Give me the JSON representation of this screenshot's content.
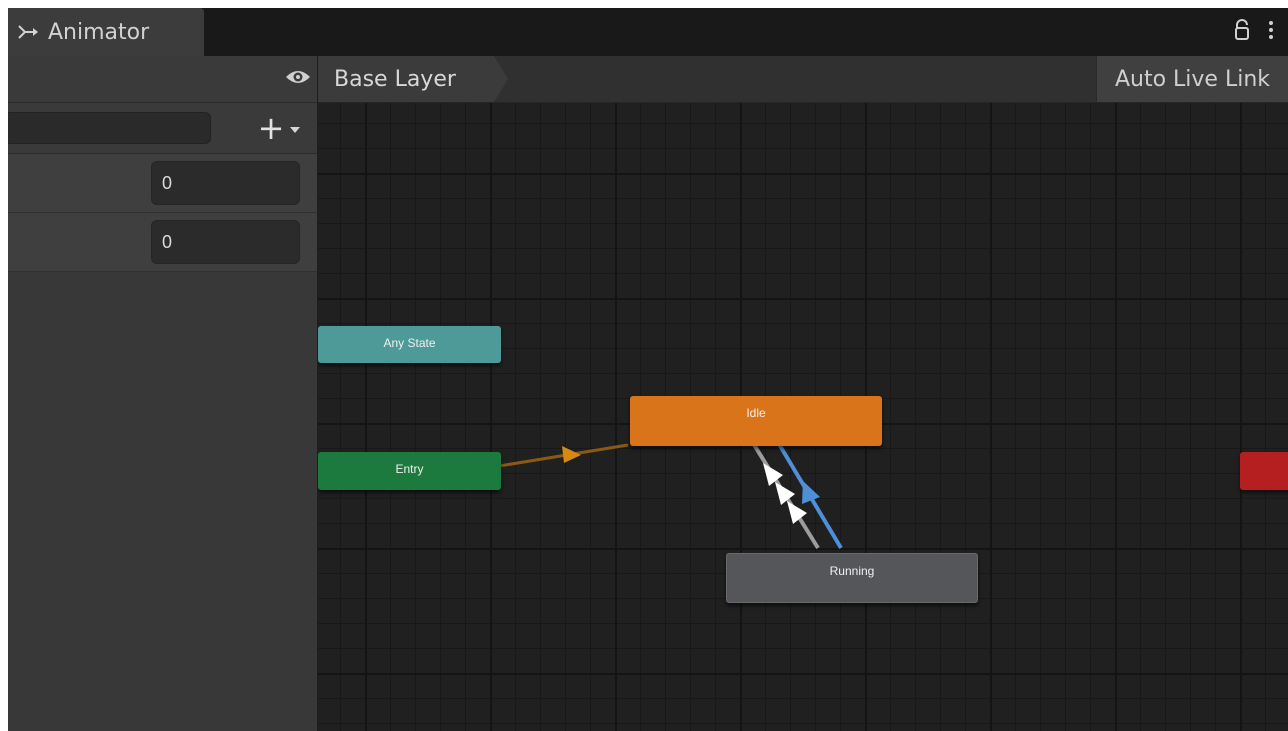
{
  "window": {
    "tab_title": "Animator",
    "icons": {
      "tab": "animator-icon",
      "lock": "lock-icon",
      "menu": "kebab-menu-icon"
    }
  },
  "parameters_panel": {
    "search": {
      "value": "",
      "placeholder": ""
    },
    "add_button": {
      "label": "+"
    },
    "visibility_icon": "eye-icon",
    "parameters": [
      {
        "value": "0"
      },
      {
        "value": "0"
      }
    ]
  },
  "graph": {
    "breadcrumb": "Base Layer",
    "auto_live_link": "Auto Live Link",
    "states": {
      "any_state": {
        "label": "Any State",
        "color": "#4e9a98"
      },
      "entry": {
        "label": "Entry",
        "color": "#1d7a3e"
      },
      "idle": {
        "label": "Idle",
        "color": "#d9741a",
        "default": true
      },
      "running": {
        "label": "Running",
        "color": "#555659"
      },
      "exit": {
        "label": "",
        "color": "#b51f1f"
      }
    },
    "transitions": [
      {
        "from": "entry",
        "to": "idle",
        "color": "#8a5a12"
      },
      {
        "from": "idle",
        "to": "running",
        "color": "#9c9c9c"
      },
      {
        "from": "running",
        "to": "idle",
        "color": "#4f8fd6",
        "selected": true
      }
    ]
  }
}
